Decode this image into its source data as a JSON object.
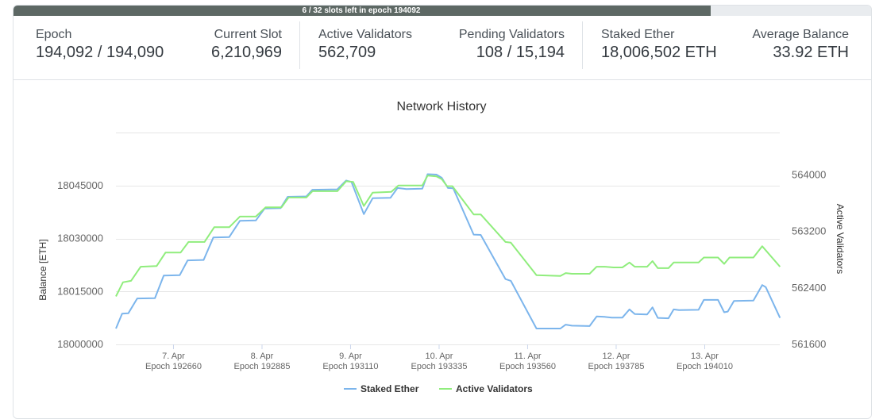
{
  "progress": {
    "text": "6 / 32 slots left in epoch 194092",
    "fraction": 0.8125
  },
  "stats": [
    {
      "label": "Epoch",
      "value": "194,092 / 194,090"
    },
    {
      "label": "Current Slot",
      "value": "6,210,969"
    },
    {
      "label": "Active Validators",
      "value": "562,709"
    },
    {
      "label": "Pending Validators",
      "value": "108 / 15,194"
    },
    {
      "label": "Staked Ether",
      "value": "18,006,502 ETH"
    },
    {
      "label": "Average Balance",
      "value": "33.92 ETH"
    }
  ],
  "chart_data": {
    "type": "line",
    "title": "Network History",
    "ylabel": "Balance [ETH]",
    "y2label": "Active Validators",
    "ylim": [
      18000000,
      18060000
    ],
    "y2lim": [
      561600,
      564600
    ],
    "yticks": [
      "18000000",
      "18015000",
      "18030000",
      "18045000"
    ],
    "y2ticks": [
      "561600",
      "562400",
      "563200",
      "564000"
    ],
    "xlim": [
      0,
      7
    ],
    "xticks": [
      {
        "x": 0.65,
        "date": "7. Apr",
        "epoch": "Epoch 192660"
      },
      {
        "x": 1.65,
        "date": "8. Apr",
        "epoch": "Epoch 192885"
      },
      {
        "x": 2.65,
        "date": "9. Apr",
        "epoch": "Epoch 193110"
      },
      {
        "x": 3.65,
        "date": "10. Apr",
        "epoch": "Epoch 193335"
      },
      {
        "x": 4.65,
        "date": "11. Apr",
        "epoch": "Epoch 193560"
      },
      {
        "x": 5.65,
        "date": "12. Apr",
        "epoch": "Epoch 193785"
      },
      {
        "x": 6.65,
        "date": "13. Apr",
        "epoch": "Epoch 194010"
      }
    ],
    "legend_position": "bottom-center",
    "grid": true,
    "series": [
      {
        "name": "Staked Ether",
        "axis": "left",
        "color": "#7cb5ec",
        "points": [
          [
            0.0,
            18004500
          ],
          [
            0.07,
            18008700
          ],
          [
            0.14,
            18008800
          ],
          [
            0.24,
            18013000
          ],
          [
            0.44,
            18013100
          ],
          [
            0.54,
            18019500
          ],
          [
            0.72,
            18019600
          ],
          [
            0.81,
            18023800
          ],
          [
            0.99,
            18023900
          ],
          [
            1.1,
            18030300
          ],
          [
            1.28,
            18030400
          ],
          [
            1.4,
            18035000
          ],
          [
            1.58,
            18035100
          ],
          [
            1.68,
            18038500
          ],
          [
            1.86,
            18038600
          ],
          [
            1.94,
            18041800
          ],
          [
            2.15,
            18041900
          ],
          [
            2.22,
            18043800
          ],
          [
            2.5,
            18043900
          ],
          [
            2.6,
            18046400
          ],
          [
            2.66,
            18046000
          ],
          [
            2.8,
            18036900
          ],
          [
            2.9,
            18041400
          ],
          [
            3.1,
            18041500
          ],
          [
            3.18,
            18044300
          ],
          [
            3.28,
            18044000
          ],
          [
            3.46,
            18044100
          ],
          [
            3.52,
            18048200
          ],
          [
            3.62,
            18048100
          ],
          [
            3.68,
            18047200
          ],
          [
            3.75,
            18044300
          ],
          [
            3.81,
            18044200
          ],
          [
            4.04,
            18031100
          ],
          [
            4.12,
            18031000
          ],
          [
            4.4,
            18018500
          ],
          [
            4.46,
            18018000
          ],
          [
            4.75,
            18004500
          ],
          [
            5.02,
            18004500
          ],
          [
            5.08,
            18005600
          ],
          [
            5.15,
            18005300
          ],
          [
            5.35,
            18005200
          ],
          [
            5.43,
            18007900
          ],
          [
            5.52,
            18007800
          ],
          [
            5.6,
            18007600
          ],
          [
            5.72,
            18007600
          ],
          [
            5.8,
            18009900
          ],
          [
            5.86,
            18008600
          ],
          [
            6.0,
            18008500
          ],
          [
            6.06,
            18010500
          ],
          [
            6.12,
            18007500
          ],
          [
            6.24,
            18007400
          ],
          [
            6.3,
            18009900
          ],
          [
            6.36,
            18009700
          ],
          [
            6.58,
            18009800
          ],
          [
            6.64,
            18012600
          ],
          [
            6.8,
            18012600
          ],
          [
            6.87,
            18009100
          ],
          [
            6.91,
            18009300
          ],
          [
            6.98,
            18012300
          ],
          [
            7.2,
            18012400
          ],
          [
            7.3,
            18016800
          ],
          [
            7.34,
            18016200
          ],
          [
            7.5,
            18007500
          ]
        ]
      },
      {
        "name": "Active Validators",
        "axis": "right",
        "color": "#90ed7d",
        "points": [
          [
            0.0,
            562280
          ],
          [
            0.08,
            562480
          ],
          [
            0.17,
            562500
          ],
          [
            0.28,
            562700
          ],
          [
            0.46,
            562710
          ],
          [
            0.56,
            562900
          ],
          [
            0.73,
            562900
          ],
          [
            0.82,
            563050
          ],
          [
            1.0,
            563050
          ],
          [
            1.11,
            563260
          ],
          [
            1.28,
            563260
          ],
          [
            1.4,
            563410
          ],
          [
            1.58,
            563410
          ],
          [
            1.69,
            563540
          ],
          [
            1.87,
            563540
          ],
          [
            1.95,
            563680
          ],
          [
            2.15,
            563680
          ],
          [
            2.22,
            563770
          ],
          [
            2.5,
            563770
          ],
          [
            2.6,
            563910
          ],
          [
            2.68,
            563900
          ],
          [
            2.8,
            563560
          ],
          [
            2.9,
            563750
          ],
          [
            3.11,
            563760
          ],
          [
            3.19,
            563850
          ],
          [
            3.46,
            563850
          ],
          [
            3.52,
            563990
          ],
          [
            3.62,
            563980
          ],
          [
            3.68,
            563940
          ],
          [
            3.74,
            563840
          ],
          [
            3.8,
            563840
          ],
          [
            4.04,
            563440
          ],
          [
            4.12,
            563440
          ],
          [
            4.4,
            563050
          ],
          [
            4.46,
            563040
          ],
          [
            4.75,
            562580
          ],
          [
            5.02,
            562570
          ],
          [
            5.08,
            562610
          ],
          [
            5.15,
            562600
          ],
          [
            5.35,
            562600
          ],
          [
            5.43,
            562700
          ],
          [
            5.52,
            562700
          ],
          [
            5.62,
            562690
          ],
          [
            5.72,
            562690
          ],
          [
            5.8,
            562760
          ],
          [
            5.86,
            562700
          ],
          [
            6.0,
            562700
          ],
          [
            6.06,
            562780
          ],
          [
            6.12,
            562680
          ],
          [
            6.24,
            562680
          ],
          [
            6.3,
            562760
          ],
          [
            6.58,
            562760
          ],
          [
            6.64,
            562830
          ],
          [
            6.8,
            562830
          ],
          [
            6.87,
            562740
          ],
          [
            6.93,
            562830
          ],
          [
            7.2,
            562830
          ],
          [
            7.3,
            562990
          ],
          [
            7.5,
            562700
          ]
        ]
      }
    ]
  }
}
